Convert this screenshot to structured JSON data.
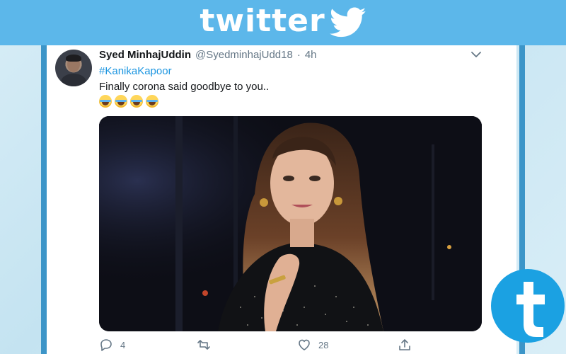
{
  "banner": {
    "wordmark": "twitter",
    "icon": "twitter-bird-icon",
    "color": "#5cb7ea"
  },
  "tweet": {
    "author": {
      "name": "Syed MinhajUddin",
      "handle": "@SyedminhajUdd18",
      "separator": "·",
      "time": "4h",
      "avatar": "user-avatar"
    },
    "hashtag": "#KanikaKapoor",
    "text": "Finally corona said goodbye to you..",
    "emojis": [
      "face-with-tears-of-joy",
      "face-with-tears-of-joy",
      "face-with-tears-of-joy",
      "face-with-tears-of-joy"
    ],
    "media": "photo of a woman in a dark sparkly dress against a dark background",
    "actions": {
      "reply_count": "4",
      "retweet_count": "",
      "like_count": "28",
      "share_label": ""
    },
    "colors": {
      "link": "#1b95e0",
      "text": "#14171a",
      "muted": "#657786"
    }
  },
  "watermark": {
    "icon": "t-logo-icon",
    "color": "#1ba1e2"
  }
}
